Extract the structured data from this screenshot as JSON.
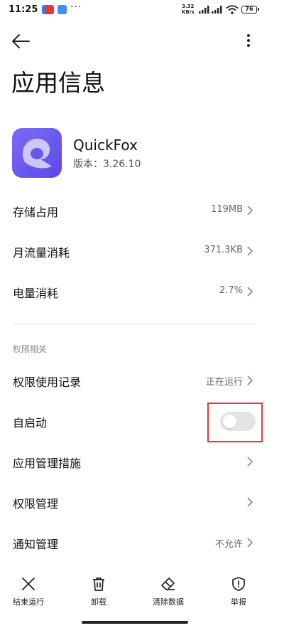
{
  "status_bar": {
    "time": "11:25",
    "more": "···",
    "net_speed_value": "3.32",
    "net_speed_unit": "KB/s",
    "battery": "76"
  },
  "header": {
    "title": "应用信息"
  },
  "app": {
    "name": "QuickFox",
    "version": "版本：3.26.10",
    "icon_color": "#6a58ee"
  },
  "rows": {
    "storage": {
      "label": "存储占用",
      "value": "119MB"
    },
    "data_usage": {
      "label": "月流量消耗",
      "value": "371.3KB"
    },
    "battery": {
      "label": "电量消耗",
      "value": "2.7%"
    }
  },
  "permissions_section": {
    "title": "权限相关",
    "permission_records": {
      "label": "权限使用记录",
      "value": "正在运行"
    },
    "autostart": {
      "label": "自启动",
      "enabled": false
    },
    "app_management": {
      "label": "应用管理措施"
    },
    "permission_management": {
      "label": "权限管理"
    },
    "notification_management": {
      "label": "通知管理",
      "value": "不允许"
    }
  },
  "bottom_bar": {
    "force_stop": "结束运行",
    "uninstall": "卸载",
    "clear_data": "清除数据",
    "report": "举报"
  },
  "colors": {
    "highlight": "#e53935",
    "toggle_off": "#e4e4e4"
  }
}
